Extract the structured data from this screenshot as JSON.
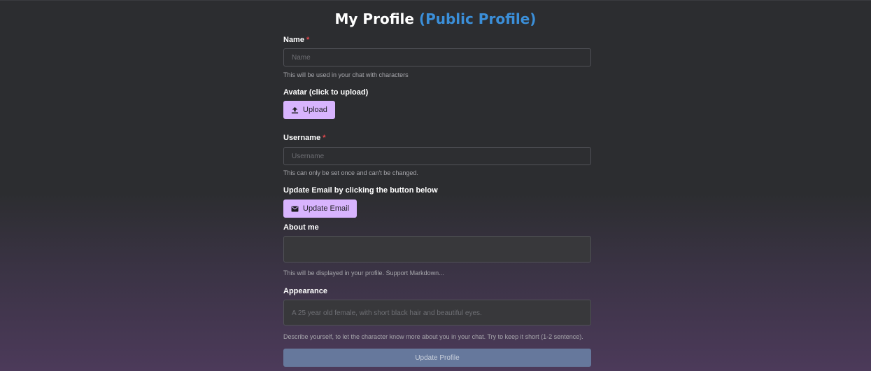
{
  "header": {
    "title": "My Profile",
    "link": "(Public Profile)"
  },
  "form": {
    "name": {
      "label": "Name",
      "required_mark": "*",
      "placeholder": "Name",
      "value": "",
      "hint": "This will be used in your chat with characters"
    },
    "avatar": {
      "label": "Avatar (click to upload)",
      "button_label": "Upload",
      "button_icon": "upload-icon"
    },
    "username": {
      "label": "Username",
      "required_mark": "*",
      "placeholder": "Username",
      "value": "",
      "hint": "This can only be set once and can't be changed."
    },
    "email": {
      "label": "Update Email by clicking the button below",
      "button_label": "Update Email",
      "button_icon": "envelope-icon"
    },
    "about": {
      "label": "About me",
      "value": "",
      "hint": "This will be displayed in your profile. Support Markdown..."
    },
    "appearance": {
      "label": "Appearance",
      "placeholder": "A 25 year old female, with short black hair and beautiful eyes.",
      "value": "",
      "hint": "Describe yourself, to let the character know more about you in your chat. Try to keep it short (1-2 sentence)."
    },
    "submit_label": "Update Profile"
  },
  "colors": {
    "background": "#2c2d30",
    "accent_purple": "#d8b4fe",
    "link_blue": "#3b8fd9",
    "required_red": "#e5484d",
    "submit_button": "#66789c"
  }
}
